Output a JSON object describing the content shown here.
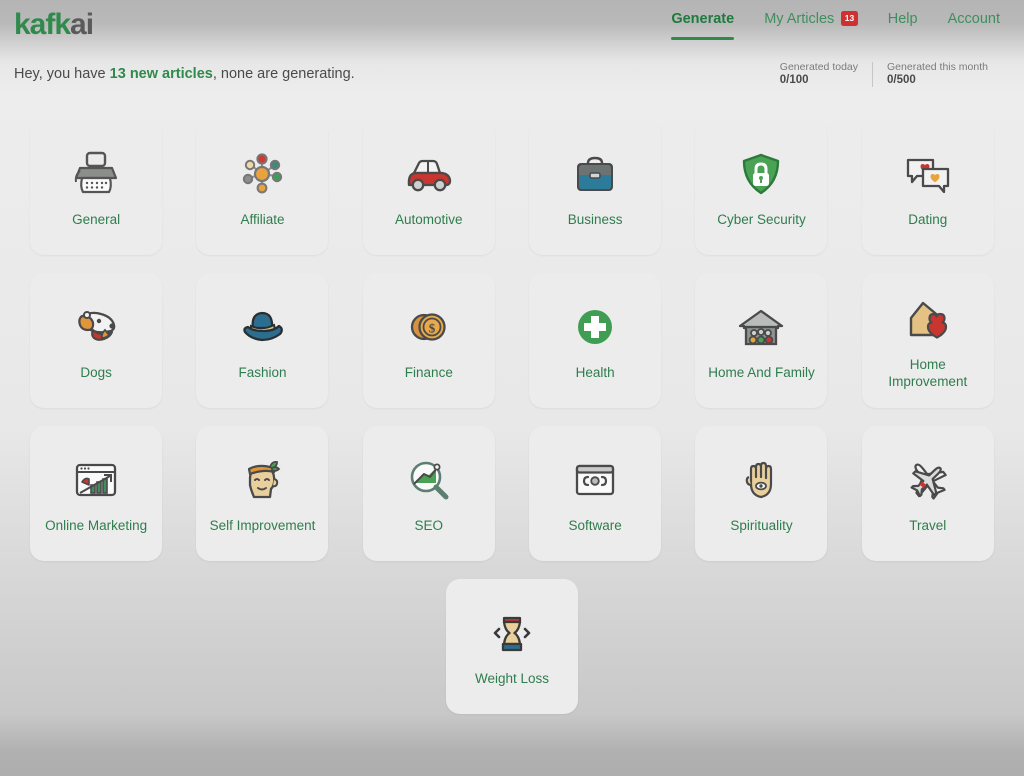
{
  "brand": {
    "name_green": "kafk",
    "name_dark": "ai"
  },
  "nav": {
    "items": [
      {
        "label": "Generate",
        "active": true,
        "badge": null,
        "icon": "generate-tab"
      },
      {
        "label": "My Articles",
        "active": false,
        "badge": "13",
        "icon": "my-articles-tab"
      },
      {
        "label": "Help",
        "active": false,
        "badge": null,
        "icon": "help-tab"
      },
      {
        "label": "Account",
        "active": false,
        "badge": null,
        "icon": "account-tab"
      }
    ]
  },
  "greeting": {
    "prefix": "Hey, you have ",
    "highlight": "13 new articles",
    "suffix": ", none are generating."
  },
  "quotas": [
    {
      "label": "Generated today",
      "value": "0/100"
    },
    {
      "label": "Generated this month",
      "value": "0/500"
    }
  ],
  "categories": [
    {
      "label": "General",
      "icon": "typewriter-icon"
    },
    {
      "label": "Affiliate",
      "icon": "network-nodes-icon"
    },
    {
      "label": "Automotive",
      "icon": "car-icon"
    },
    {
      "label": "Business",
      "icon": "briefcase-icon"
    },
    {
      "label": "Cyber Security",
      "icon": "shield-lock-icon"
    },
    {
      "label": "Dating",
      "icon": "heart-chat-bubbles-icon"
    },
    {
      "label": "Dogs",
      "icon": "dog-head-icon"
    },
    {
      "label": "Fashion",
      "icon": "sun-hat-icon"
    },
    {
      "label": "Finance",
      "icon": "dollar-coins-icon"
    },
    {
      "label": "Health",
      "icon": "medical-cross-icon"
    },
    {
      "label": "Home And Family",
      "icon": "house-family-icon"
    },
    {
      "label": "Home Improvement",
      "icon": "house-heart-icon"
    },
    {
      "label": "Online Marketing",
      "icon": "browser-chart-icon"
    },
    {
      "label": "Self Improvement",
      "icon": "head-plant-icon"
    },
    {
      "label": "SEO",
      "icon": "magnifier-chart-icon"
    },
    {
      "label": "Software",
      "icon": "browser-code-icon"
    },
    {
      "label": "Spirituality",
      "icon": "hamsa-hand-icon"
    },
    {
      "label": "Travel",
      "icon": "airplanes-icon"
    },
    {
      "label": "Weight Loss",
      "icon": "waist-measure-icon"
    }
  ],
  "colors": {
    "brand_green": "#2f8a4c",
    "label_green": "#2f7d4e",
    "badge_red": "#cf3030",
    "page_bg": "#e8e8e8",
    "card_bg": "#ececec"
  }
}
